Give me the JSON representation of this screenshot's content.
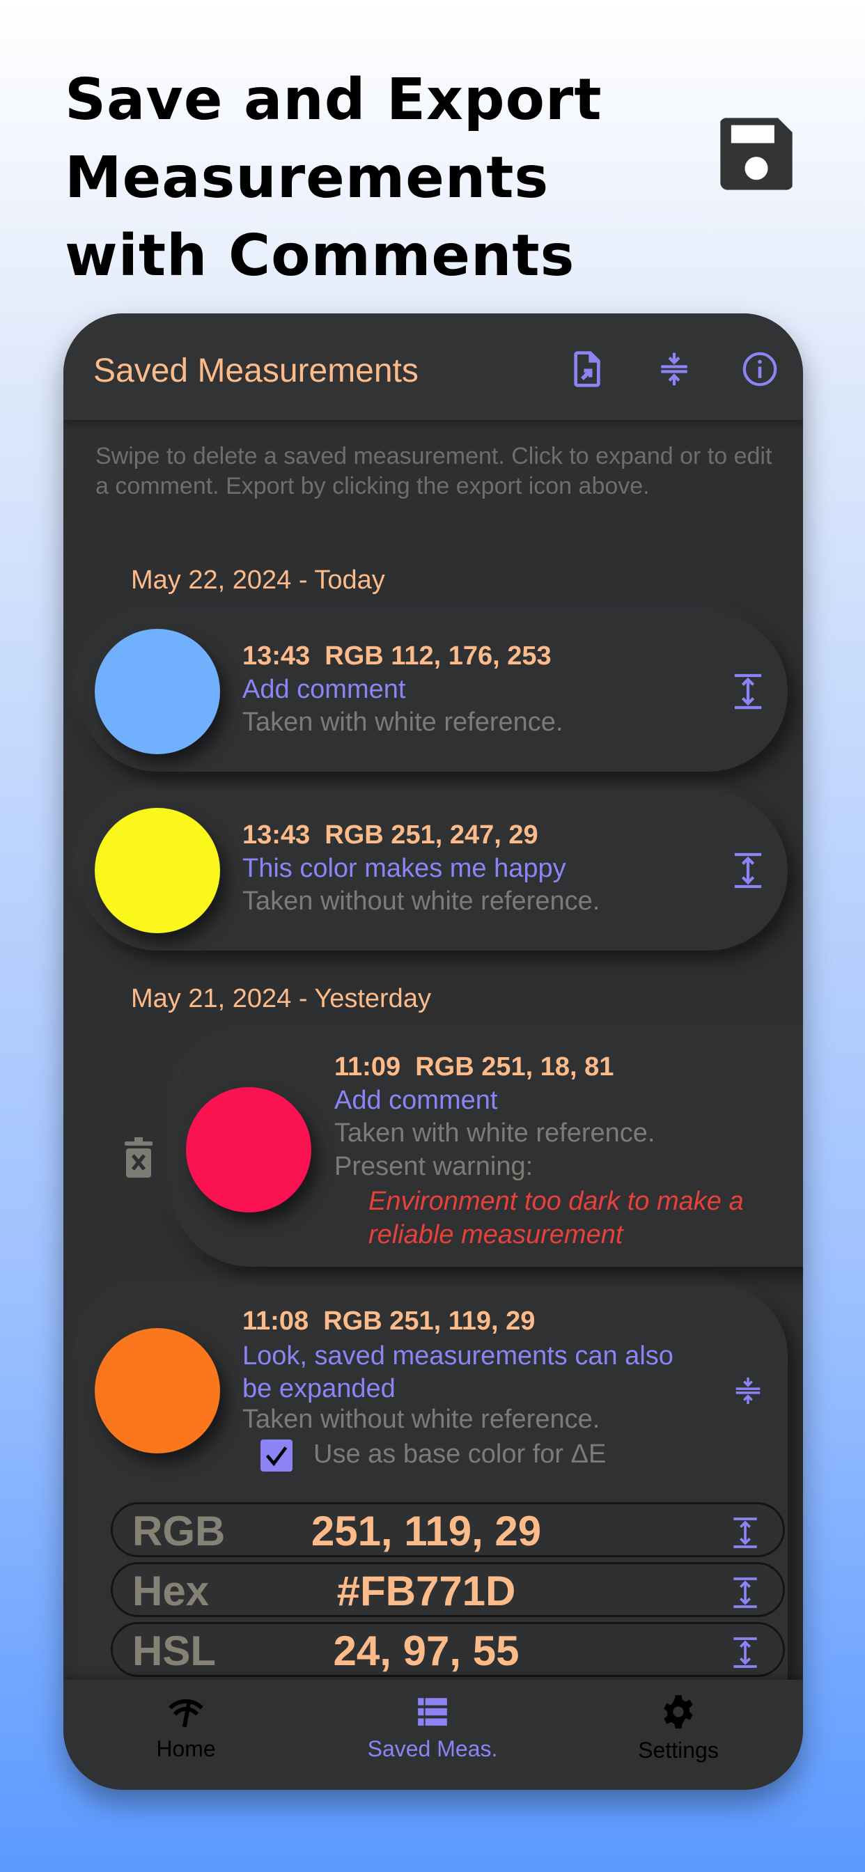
{
  "headline": [
    "Save and Export",
    "Measurements",
    "with Comments"
  ],
  "header": {
    "title": "Saved Measurements",
    "icons": [
      "export-file-icon",
      "collapse-all-icon",
      "info-icon"
    ]
  },
  "help_text": "Swipe to delete a saved measurement. Click to expand or to edit a comment. Export by clicking the export icon above.",
  "groups": [
    {
      "date": "May 22, 2024 - Today",
      "items": [
        {
          "title": "13:43  RGB 112, 176, 253",
          "comment": "Add comment",
          "reference": "Taken with white reference.",
          "color": "#70b0fd"
        },
        {
          "title": "13:43  RGB 251, 247, 29",
          "comment": "This color makes me happy",
          "reference": "Taken without white reference.",
          "color": "#fbf71d"
        }
      ]
    },
    {
      "date": "May 21, 2024 - Yesterday",
      "items": [
        {
          "title": "11:09  RGB 251, 18, 81",
          "comment": "Add comment",
          "reference": "Taken with white reference.",
          "warning_label": "Present warning:",
          "warning": "Environment too dark to make a reliable measurement",
          "color": "#fb1251"
        },
        {
          "title": "11:08  RGB 251, 119, 29",
          "comment": "Look, saved measurements can also be expanded",
          "reference": "Taken without white reference.",
          "checkbox_label": "Use as base color for ΔE",
          "checkbox_checked": true,
          "color": "#fb771d",
          "values": [
            {
              "label": "RGB",
              "value": "251, 119, 29"
            },
            {
              "label": "Hex",
              "value": "#FB771D"
            },
            {
              "label": "HSL",
              "value": "24, 97, 55"
            }
          ]
        }
      ]
    }
  ],
  "tabs": [
    {
      "label": "Home",
      "active": false
    },
    {
      "label": "Saved Meas.",
      "active": true
    },
    {
      "label": "Settings",
      "active": false
    }
  ],
  "colors": {
    "accent": "#8c84f5",
    "peach": "#fdbb8a",
    "card": "#2e2f31",
    "warning": "#e8403a"
  }
}
